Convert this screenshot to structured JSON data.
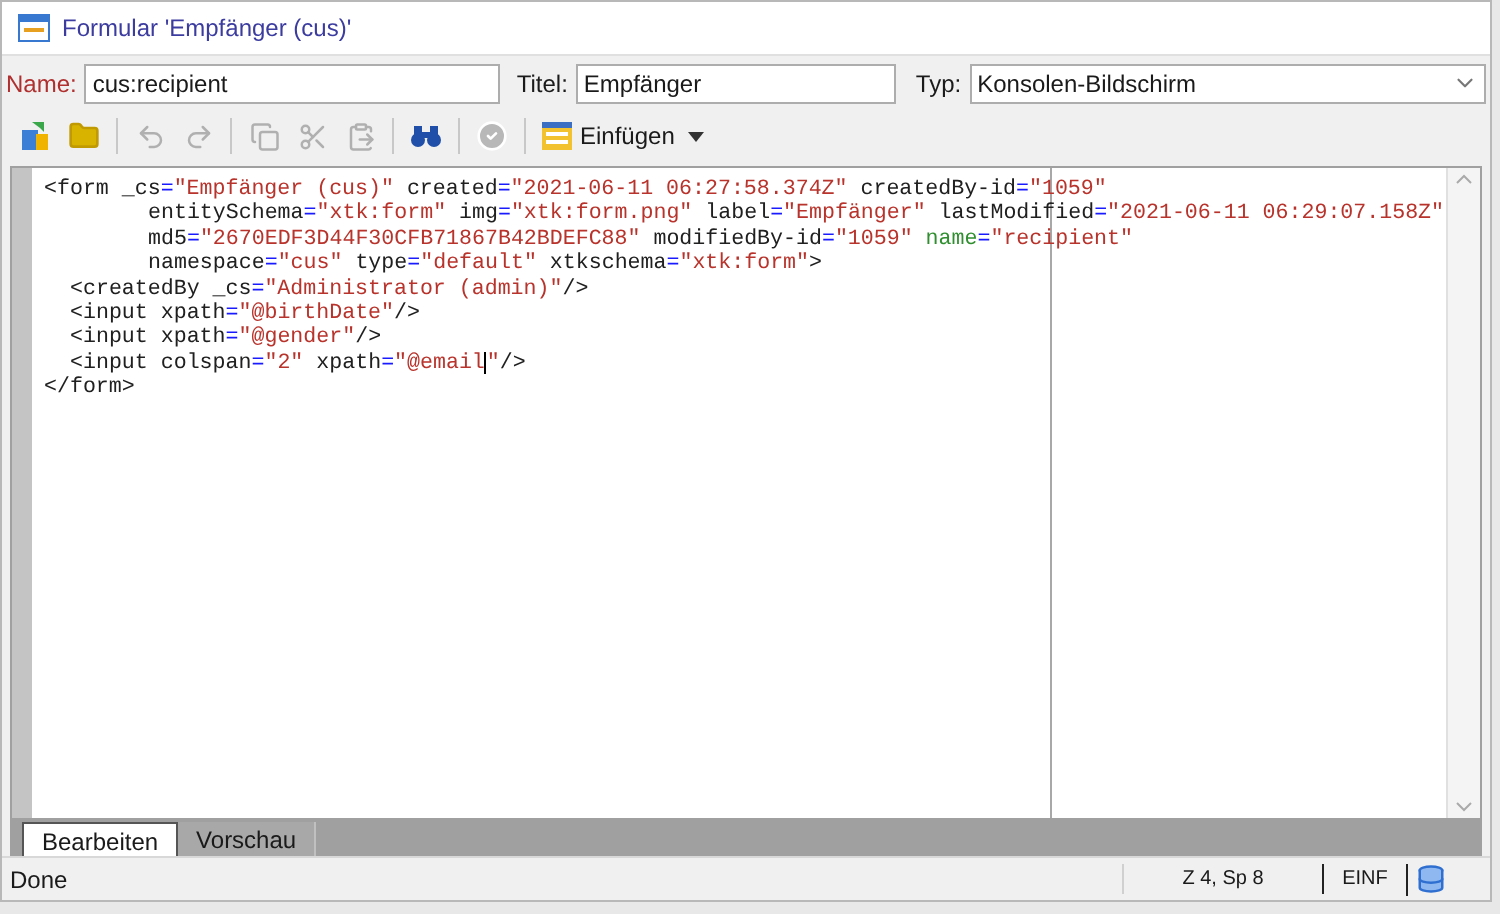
{
  "window": {
    "title": "Formular 'Empfänger (cus)'"
  },
  "header": {
    "name": {
      "label": "Name:",
      "value": "cus:recipient"
    },
    "title": {
      "label": "Titel:",
      "value": "Empfänger"
    },
    "type": {
      "label": "Typ:",
      "value": "Konsolen-Bildschirm"
    }
  },
  "toolbar": [
    {
      "kind": "button",
      "disabled": false
    },
    {
      "kind": "button",
      "disabled": false
    },
    {
      "kind": "separator"
    },
    {
      "kind": "button",
      "disabled": true
    },
    {
      "kind": "button",
      "disabled": true
    },
    {
      "kind": "separator"
    },
    {
      "kind": "button",
      "disabled": true
    },
    {
      "kind": "button",
      "disabled": true
    },
    {
      "kind": "button",
      "disabled": true
    },
    {
      "kind": "separator"
    },
    {
      "kind": "button",
      "disabled": false
    },
    {
      "kind": "separator"
    },
    {
      "kind": "button",
      "disabled": true
    },
    {
      "kind": "separator"
    },
    {
      "kind": "menu",
      "label": "Einfügen",
      "disabled": false
    }
  ],
  "editor": {
    "lines": [
      {
        "kind": "open",
        "tokens": [
          {
            "kind": "tag",
            "text": "<form"
          },
          {
            "kind": "attr",
            "text": " _cs"
          },
          {
            "kind": "eq",
            "text": "="
          },
          {
            "kind": "value",
            "text": "\"Empfänger (cus)\""
          },
          {
            "kind": "attr",
            "text": " created"
          },
          {
            "kind": "eq",
            "text": "="
          },
          {
            "kind": "value",
            "text": "\"2021-06-11 06:27:58.374Z\""
          },
          {
            "kind": "attr",
            "text": " createdBy-id"
          },
          {
            "kind": "eq",
            "text": "="
          },
          {
            "kind": "value",
            "text": "\"1059\""
          }
        ]
      },
      {
        "kind": "continuation",
        "tokens": [
          {
            "kind": "attr",
            "text": "entitySchema"
          },
          {
            "kind": "eq",
            "text": "="
          },
          {
            "kind": "value",
            "text": "\"xtk:form\""
          },
          {
            "kind": "attr",
            "text": " img"
          },
          {
            "kind": "eq",
            "text": "="
          },
          {
            "kind": "value",
            "text": "\"xtk:form.png\""
          },
          {
            "kind": "attr",
            "text": " label"
          },
          {
            "kind": "eq",
            "text": "="
          },
          {
            "kind": "value",
            "text": "\"Empfänger\""
          },
          {
            "kind": "attr",
            "text": " lastModified"
          },
          {
            "kind": "eq",
            "text": "="
          },
          {
            "kind": "value",
            "text": "\"2021-06-11 06:29:07.158Z\""
          }
        ]
      },
      {
        "kind": "continuation",
        "tokens": [
          {
            "kind": "attr",
            "text": "md5"
          },
          {
            "kind": "eq",
            "text": "="
          },
          {
            "kind": "value",
            "text": "\"2670EDF3D44F30CFB71867B42BDEFC88\""
          },
          {
            "kind": "attr",
            "text": " modifiedBy-id"
          },
          {
            "kind": "eq",
            "text": "="
          },
          {
            "kind": "value",
            "text": "\"1059\""
          },
          {
            "kind": "key",
            "text": " name"
          },
          {
            "kind": "eq",
            "text": "="
          },
          {
            "kind": "value",
            "text": "\"recipient\""
          }
        ]
      },
      {
        "kind": "continuation",
        "tokens": [
          {
            "kind": "attr",
            "text": "namespace"
          },
          {
            "kind": "eq",
            "text": "="
          },
          {
            "kind": "value",
            "text": "\"cus\""
          },
          {
            "kind": "attr",
            "text": " type"
          },
          {
            "kind": "eq",
            "text": "="
          },
          {
            "kind": "value",
            "text": "\"default\""
          },
          {
            "kind": "attr",
            "text": " xtkschema"
          },
          {
            "kind": "eq",
            "text": "="
          },
          {
            "kind": "value",
            "text": "\"xtk:form\""
          },
          {
            "kind": "tag",
            "text": ">"
          }
        ]
      },
      {
        "kind": "child",
        "tokens": [
          {
            "kind": "tag",
            "text": "<createdBy"
          },
          {
            "kind": "attr",
            "text": " _cs"
          },
          {
            "kind": "eq",
            "text": "="
          },
          {
            "kind": "value",
            "text": "\"Administrator (admin)\""
          },
          {
            "kind": "tag",
            "text": "/>"
          }
        ]
      },
      {
        "kind": "child",
        "tokens": [
          {
            "kind": "tag",
            "text": "<input"
          },
          {
            "kind": "attr",
            "text": " xpath"
          },
          {
            "kind": "eq",
            "text": "="
          },
          {
            "kind": "value",
            "text": "\"@birthDate\""
          },
          {
            "kind": "tag",
            "text": "/>"
          }
        ]
      },
      {
        "kind": "child",
        "tokens": [
          {
            "kind": "tag",
            "text": "<input"
          },
          {
            "kind": "attr",
            "text": " xpath"
          },
          {
            "kind": "eq",
            "text": "="
          },
          {
            "kind": "value",
            "text": "\"@gender\""
          },
          {
            "kind": "tag",
            "text": "/>"
          }
        ]
      },
      {
        "kind": "child",
        "tokens": [
          {
            "kind": "tag",
            "text": "<input"
          },
          {
            "kind": "attr",
            "text": " colspan"
          },
          {
            "kind": "eq",
            "text": "="
          },
          {
            "kind": "value",
            "text": "\"2\""
          },
          {
            "kind": "attr",
            "text": " xpath"
          },
          {
            "kind": "eq",
            "text": "="
          },
          {
            "kind": "value",
            "text": "\"@email",
            "cursor_after": true
          },
          {
            "kind": "value",
            "text": "\""
          },
          {
            "kind": "tag",
            "text": "/>"
          }
        ]
      },
      {
        "kind": "open",
        "tokens": [
          {
            "kind": "tag",
            "text": "</form>"
          }
        ]
      }
    ]
  },
  "tabs": [
    {
      "label": "Bearbeiten",
      "selected": true
    },
    {
      "label": "Vorschau",
      "selected": false
    }
  ],
  "status_bar": {
    "message": "Done",
    "position": "Z 4, Sp 8",
    "mode": "EINF"
  }
}
